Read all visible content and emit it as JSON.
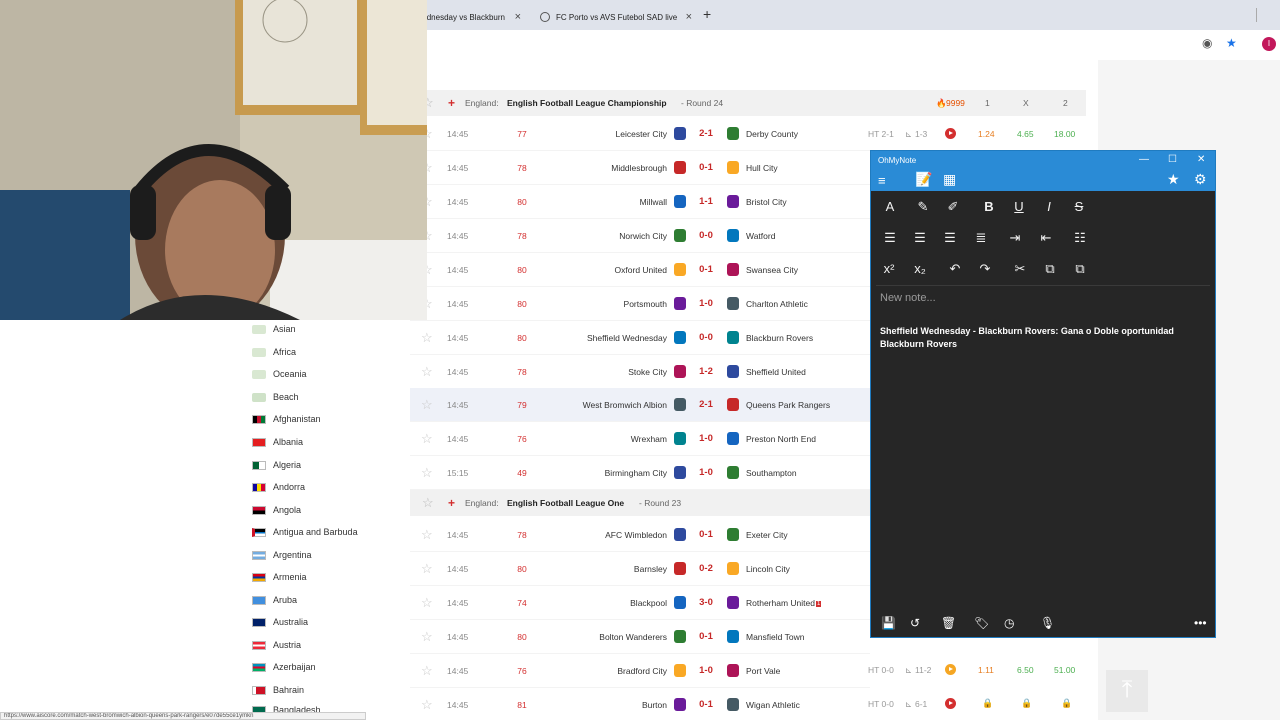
{
  "tabs": [
    {
      "label": "Sheffield Wednesday vs Blackburn"
    },
    {
      "label": "FC Porto vs AVS Futebol SAD live"
    }
  ],
  "profile_letter": "I",
  "sidebar": {
    "items": [
      {
        "label": "Asian"
      },
      {
        "label": "Africa"
      },
      {
        "label": "Oceania"
      },
      {
        "label": "Beach"
      },
      {
        "label": "Afghanistan"
      },
      {
        "label": "Albania"
      },
      {
        "label": "Algeria"
      },
      {
        "label": "Andorra"
      },
      {
        "label": "Angola"
      },
      {
        "label": "Antigua and Barbuda"
      },
      {
        "label": "Argentina"
      },
      {
        "label": "Armenia"
      },
      {
        "label": "Aruba"
      },
      {
        "label": "Australia"
      },
      {
        "label": "Austria"
      },
      {
        "label": "Azerbaijan"
      },
      {
        "label": "Bahrain"
      },
      {
        "label": "Bangladesh"
      }
    ]
  },
  "section1": {
    "country": "England:",
    "league": "English Football League Championship",
    "round": "- Round 24",
    "hot_count": "9999",
    "col1": "1",
    "colx": "X",
    "col2": "2"
  },
  "section2": {
    "country": "England:",
    "league": "English Football League One",
    "round": "- Round 23"
  },
  "matches_championship": [
    {
      "time": "14:45",
      "minute": "77",
      "home": "Leicester City",
      "score": "2-1",
      "away": "Derby County",
      "ht": "HT 2-1",
      "corners": "1-3",
      "odd1": "1.24",
      "oddx": "4.65",
      "odd2": "18.00"
    },
    {
      "time": "14:45",
      "minute": "78",
      "home": "Middlesbrough",
      "score": "0-1",
      "away": "Hull City"
    },
    {
      "time": "14:45",
      "minute": "80",
      "home": "Millwall",
      "score": "1-1",
      "away": "Bristol City"
    },
    {
      "time": "14:45",
      "minute": "78",
      "home": "Norwich City",
      "score": "0-0",
      "away": "Watford"
    },
    {
      "time": "14:45",
      "minute": "80",
      "home": "Oxford United",
      "score": "0-1",
      "away": "Swansea City"
    },
    {
      "time": "14:45",
      "minute": "80",
      "home": "Portsmouth",
      "score": "1-0",
      "away": "Charlton Athletic"
    },
    {
      "time": "14:45",
      "minute": "80",
      "home": "Sheffield Wednesday",
      "score": "0-0",
      "away": "Blackburn Rovers"
    },
    {
      "time": "14:45",
      "minute": "78",
      "home": "Stoke City",
      "score": "1-2",
      "away": "Sheffield United"
    },
    {
      "time": "14:45",
      "minute": "79",
      "home": "West Bromwich Albion",
      "score": "2-1",
      "away": "Queens Park Rangers"
    },
    {
      "time": "14:45",
      "minute": "76",
      "home": "Wrexham",
      "score": "1-0",
      "away": "Preston North End"
    },
    {
      "time": "15:15",
      "minute": "49",
      "home": "Birmingham City",
      "score": "1-0",
      "away": "Southampton"
    }
  ],
  "matches_league_one": [
    {
      "time": "14:45",
      "minute": "78",
      "home": "AFC Wimbledon",
      "score": "0-1",
      "away": "Exeter City"
    },
    {
      "time": "14:45",
      "minute": "80",
      "home": "Barnsley",
      "score": "0-2",
      "away": "Lincoln City"
    },
    {
      "time": "14:45",
      "minute": "74",
      "home": "Blackpool",
      "score": "3-0",
      "away": "Rotherham United",
      "red_cards": "1"
    },
    {
      "time": "14:45",
      "minute": "80",
      "home": "Bolton Wanderers",
      "score": "0-1",
      "away": "Mansfield Town"
    },
    {
      "time": "14:45",
      "minute": "76",
      "home": "Bradford City",
      "score": "1-0",
      "away": "Port Vale",
      "ht": "HT 0-0",
      "corners": "11-2",
      "odd1": "1.11",
      "oddx": "6.50",
      "odd2": "51.00"
    },
    {
      "time": "14:45",
      "minute": "81",
      "home": "Burton",
      "score": "0-1",
      "away": "Wigan Athletic",
      "ht": "HT 0-0",
      "corners": "6-1"
    }
  ],
  "note": {
    "app_name": "OhMyNote",
    "placeholder": "New note...",
    "text": "Sheffield Wednesday - Blackburn Rovers: Gana o Doble oportunidad Blackburn Rovers"
  },
  "status_url": "https://www.aiscore.com/match-west-bromwich-albion-queens-park-rangers/e07de55ce1ymkn",
  "colors": {
    "score_red": "#c62828",
    "minute_red": "#d32f2f",
    "odds_orange": "#e67e22",
    "odds_green": "#4caf50",
    "note_titlebar": "#2a8bd6",
    "note_body": "#262626"
  }
}
